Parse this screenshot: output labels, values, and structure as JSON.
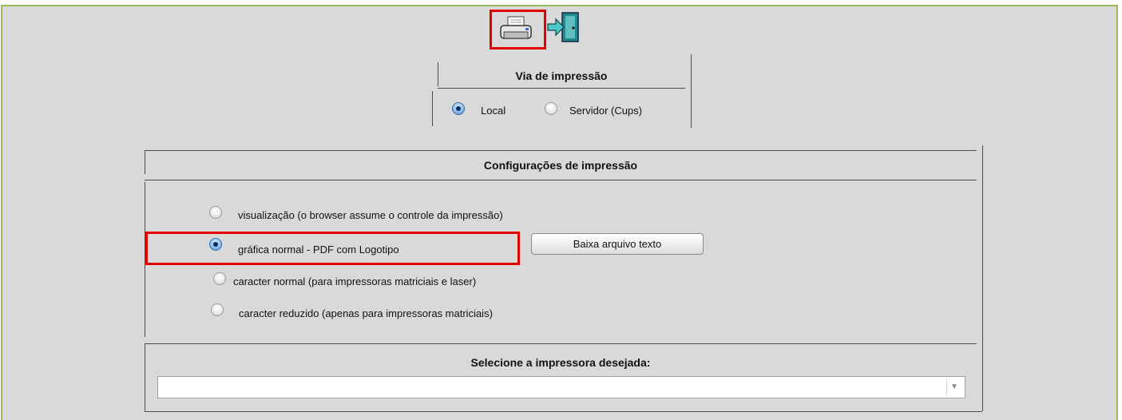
{
  "toolbar": {
    "print_icon": "printer-icon",
    "exit_icon": "exit-door-icon"
  },
  "via": {
    "title": "Via de impressão",
    "local_label": "Local",
    "servidor_label": "Servidor (Cups)",
    "selected": "Local"
  },
  "config": {
    "title": "Configurações de impressão",
    "options": [
      {
        "label": "visualização (o browser assume o controle da impressão)",
        "selected": false
      },
      {
        "label": "gráfica normal - PDF com Logotipo",
        "selected": true
      },
      {
        "label": "caracter normal (para impressoras matriciais e laser)",
        "selected": false
      },
      {
        "label": "caracter reduzido (apenas para impressoras matriciais)",
        "selected": false
      }
    ],
    "download_button": "Baixa arquivo texto"
  },
  "printer": {
    "title": "Selecione a impressora desejada:",
    "value": ""
  },
  "colors": {
    "highlight": "#e00000",
    "frame_border": "#9bbb59",
    "background": "#d9d9d9"
  }
}
